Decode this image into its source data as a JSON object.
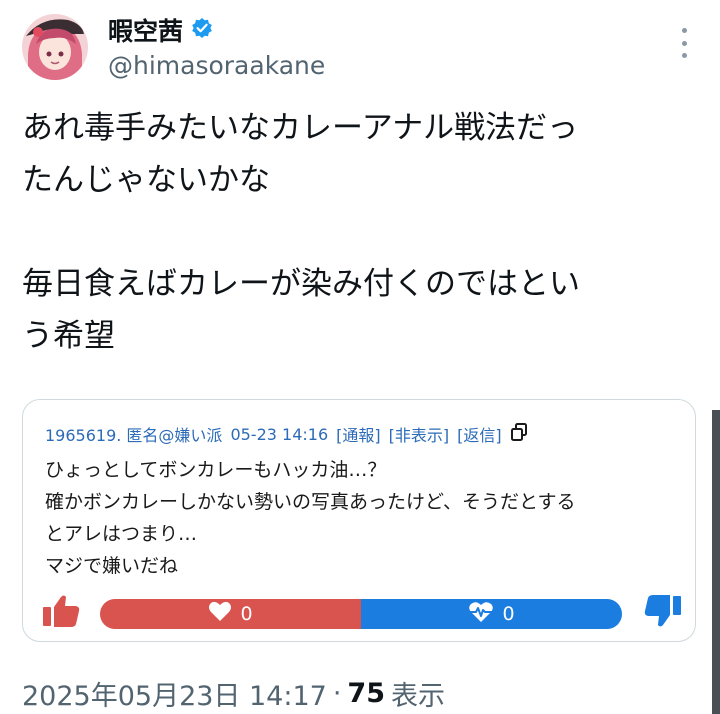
{
  "author": {
    "display_name": "暇空茜",
    "handle": "@himasoraakane",
    "verified": true,
    "accent": "#1d9bf0"
  },
  "post": {
    "text": "あれ毒手みたいなカレーアナル戦法だっ\nたんじゃないかな\n\n毎日食えばカレーが染み付くのではとい\nう希望"
  },
  "quoted_card": {
    "meta": {
      "id_name": "1965619. 匿名@嫌い派",
      "datetime": "05-23 14:16",
      "report": "[通報]",
      "hide": "[非表示]",
      "reply": "[返信]"
    },
    "body": "ひょっとしてボンカレーもハッカ油…？\n確かボンカレーしかない勢いの写真あったけど、そうだとする\nとアレはつまり…\nマジで嫌いだね",
    "votes": {
      "like": "0",
      "dislike": "0",
      "like_color": "#d9534f",
      "dislike_color": "#1c7de0"
    }
  },
  "footer": {
    "timestamp": "2025年05月23日 14:17",
    "separator": "·",
    "views_count": "75",
    "views_label": "表示"
  }
}
